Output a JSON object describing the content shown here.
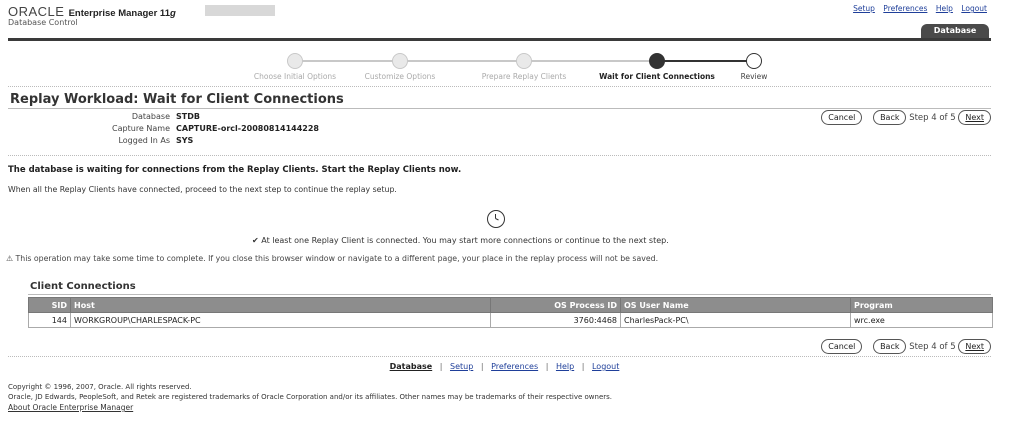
{
  "header": {
    "brand": "ORACLE",
    "product": "Enterprise Manager 11",
    "product_suffix": "g",
    "subtitle": "Database Control",
    "global_links": [
      "Setup",
      "Preferences",
      "Help",
      "Logout"
    ],
    "tab_label": "Database"
  },
  "train": {
    "steps": [
      {
        "label": "Choose Initial Options",
        "state": "done"
      },
      {
        "label": "Customize Options",
        "state": "done"
      },
      {
        "label": "Prepare Replay Clients",
        "state": "done"
      },
      {
        "label": "Wait for Client Connections",
        "state": "active"
      },
      {
        "label": "Review",
        "state": "future"
      }
    ]
  },
  "page": {
    "title": "Replay Workload: Wait for Client Connections",
    "info": [
      {
        "label": "Database",
        "value": "STDB"
      },
      {
        "label": "Capture Name",
        "value": "CAPTURE-orcl-20080814144228"
      },
      {
        "label": "Logged In As",
        "value": "SYS"
      }
    ]
  },
  "nav": {
    "cancel": "Cancel",
    "back": "Back",
    "step_text": "Step 4 of 5",
    "next": "Next"
  },
  "messages": {
    "bold": "The database is waiting for connections from the Replay Clients. Start the Replay Clients now.",
    "info": "When all the Replay Clients have connected, proceed to the next step to continue the replay setup.",
    "status_check": "✔",
    "status": "At least one Replay Client is connected. You may start more connections or continue to the next step.",
    "warn_icon": "⚠",
    "warning": "This operation may take some time to complete. If you close this browser window or navigate to a different page, your place in the replay process will not be saved."
  },
  "client_connections": {
    "title": "Client Connections",
    "columns": [
      "SID",
      "Host",
      "OS Process ID",
      "OS User Name",
      "Program"
    ],
    "rows": [
      {
        "sid": "144",
        "host": "WORKGROUP\\CHARLESPACK-PC",
        "os_process_id": "3760:4468",
        "os_user": "CharlesPack-PC\\",
        "program": "wrc.exe"
      }
    ]
  },
  "footer": {
    "links": [
      "Database",
      "Setup",
      "Preferences",
      "Help",
      "Logout"
    ],
    "copyright": "Copyright © 1996, 2007, Oracle. All rights reserved.",
    "trademark": "Oracle, JD Edwards, PeopleSoft, and Retek are registered trademarks of Oracle Corporation and/or its affiliates. Other names may be trademarks of their respective owners.",
    "about": "About Oracle Enterprise Manager"
  }
}
